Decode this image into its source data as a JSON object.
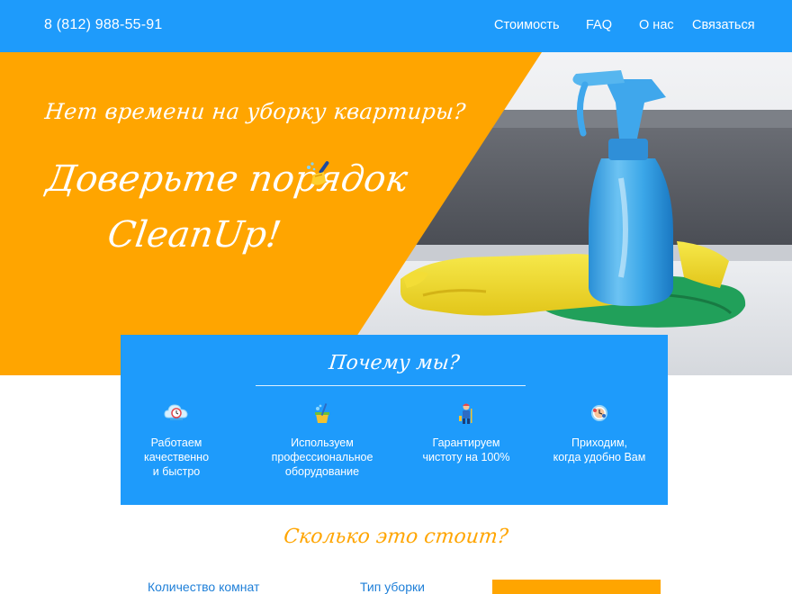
{
  "header": {
    "phone": "8 (812) 988-55-91",
    "nav": [
      "Стоимость",
      "FAQ",
      "О нас",
      "Связаться"
    ]
  },
  "hero": {
    "tagline": "Нет времени на уборку квартиры?",
    "headline_line1": "Доверьте порядок",
    "headline_line2": "CleanUp!"
  },
  "why": {
    "title": "Почему мы?",
    "features": [
      {
        "icon": "cloud-clock-icon",
        "text": "Работаем\nкачественно\nи быстро"
      },
      {
        "icon": "cleaning-bucket-icon",
        "text": "Используем\nпрофессиональное\nоборудование"
      },
      {
        "icon": "cleaner-person-icon",
        "text": "Гарантируем\nчистоту на 100%"
      },
      {
        "icon": "clock-badge-icon",
        "text": "Приходим,\nкогда удобно Вам"
      }
    ]
  },
  "pricing": {
    "title": "Сколько это стоит?",
    "rooms_label": "Количество комнат",
    "type_label": "Тип уборки"
  },
  "colors": {
    "primary_blue": "#1e9bfb",
    "accent_orange": "#ffa500",
    "white": "#ffffff"
  }
}
